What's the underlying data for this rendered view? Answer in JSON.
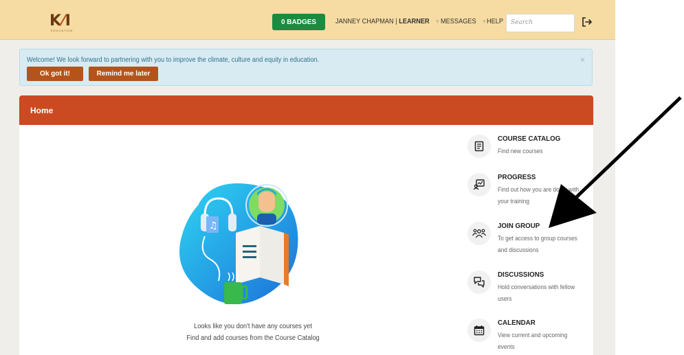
{
  "brand": {
    "logo_text": "KOI",
    "logo_sub": "EDUCATION"
  },
  "topbar": {
    "badges_label": "0 BADGES",
    "user_name": "JANNEY CHAPMAN |",
    "user_role": "LEARNER",
    "messages_label": "MESSAGES",
    "help_label": "HELP",
    "search_placeholder": "Search"
  },
  "alert": {
    "text": "Welcome! We look forward to partnering with you to improve the climate, culture and equity in education.",
    "ok_label": "Ok got it!",
    "remind_label": "Remind me later",
    "close": "×"
  },
  "home": {
    "title": "Home",
    "empty_line1": "Looks like you don't have any courses yet",
    "empty_line2": "Find and add courses from the Course Catalog"
  },
  "menu": [
    {
      "title": "COURSE CATALOG",
      "desc": "Find new courses",
      "icon": "book-icon"
    },
    {
      "title": "PROGRESS",
      "desc": "Find out how you are doing with your training",
      "icon": "progress-chart-icon"
    },
    {
      "title": "JOIN GROUP",
      "desc": "To get access to group courses and discussions",
      "icon": "users-group-icon"
    },
    {
      "title": "DISCUSSIONS",
      "desc": "Hold conversations with fellow users",
      "icon": "chat-bubbles-icon"
    },
    {
      "title": "CALENDAR",
      "desc": "View current and upcoming events",
      "icon": "calendar-icon"
    }
  ],
  "colors": {
    "topbar": "#f6dca3",
    "badge_green": "#1d8a3f",
    "header_orange": "#cc4a22",
    "button_brown": "#b3541c",
    "alert_bg": "#d8ebf2"
  }
}
